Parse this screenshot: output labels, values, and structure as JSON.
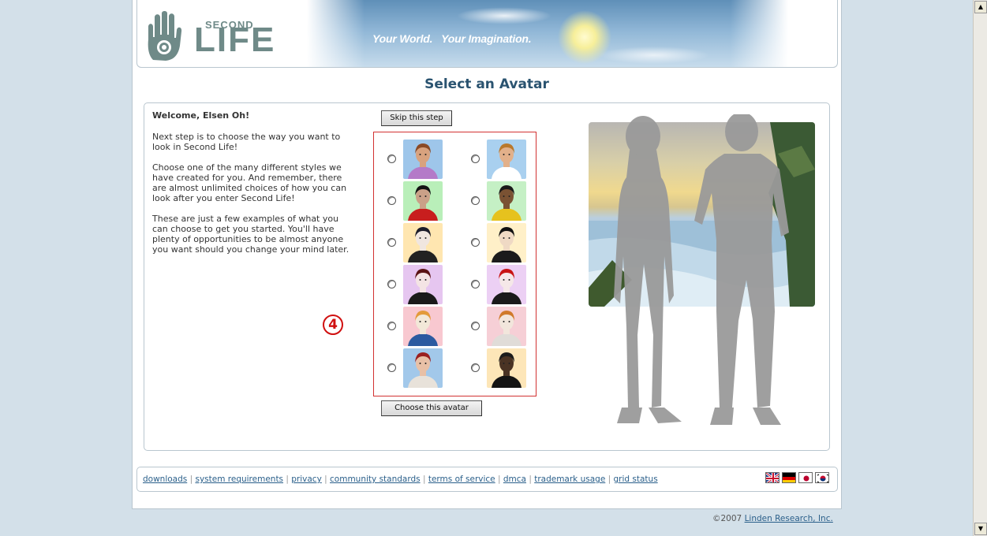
{
  "header": {
    "logo_second": "SECOND",
    "logo_life": "LIFE",
    "tagline": "Your World.   Your Imagination."
  },
  "page_title": "Select an Avatar",
  "left_panel": {
    "welcome": "Welcome, Elsen Oh!",
    "paragraphs": [
      "Next step is to choose the way you want to look in Second Life!",
      "Choose one of the many different styles we have created for you. And remember, there are almost unlimited choices of how you can look after you enter Second Life!",
      "These are just a few examples of what you can choose to get you started. You'll have plenty of opportunities to be almost anyone you want should you change your mind later."
    ]
  },
  "buttons": {
    "skip": "Skip this step",
    "choose": "Choose this avatar"
  },
  "marker": "4",
  "avatars": [
    {
      "bg": "#9ec6ea",
      "skin": "#d8a27e",
      "hair": "#8a4a26",
      "shirt": "#b47ac8"
    },
    {
      "bg": "#a9d0ef",
      "skin": "#e2b08a",
      "hair": "#b9782c",
      "shirt": "#ffffff"
    },
    {
      "bg": "#b9efb9",
      "skin": "#caa088",
      "hair": "#141414",
      "shirt": "#c81e1e"
    },
    {
      "bg": "#c5f0c5",
      "skin": "#7a5233",
      "hair": "#1a1a1a",
      "shirt": "#e6c21e"
    },
    {
      "bg": "#ffe6b0",
      "skin": "#f0e6e0",
      "hair": "#1c1c2a",
      "shirt": "#222222"
    },
    {
      "bg": "#fff0c8",
      "skin": "#efd9c4",
      "hair": "#111111",
      "shirt": "#1b1b1b"
    },
    {
      "bg": "#e6c6f0",
      "skin": "#f4e4e4",
      "hair": "#5a1414",
      "shirt": "#1a1a1a"
    },
    {
      "bg": "#ecd0f4",
      "skin": "#f5e8e8",
      "hair": "#c81414",
      "shirt": "#1a1a1a"
    },
    {
      "bg": "#f8c8d0",
      "skin": "#f2e8d8",
      "hair": "#e39a3a",
      "shirt": "#2c5aa0"
    },
    {
      "bg": "#f6cfd6",
      "skin": "#f2e6dc",
      "hair": "#d07a2a",
      "shirt": "#e0dcd8"
    },
    {
      "bg": "#a2c8ea",
      "skin": "#e8c0a6",
      "hair": "#9a2020",
      "shirt": "#e8e2da"
    },
    {
      "bg": "#fde6b8",
      "skin": "#4a3324",
      "hair": "#1c1c1c",
      "shirt": "#141414"
    }
  ],
  "footer": {
    "links": [
      "downloads",
      "system requirements",
      "privacy",
      "community standards",
      "terms of service",
      "dmca",
      "trademark usage",
      "grid status"
    ],
    "flags": [
      "uk-flag-icon",
      "germany-flag-icon",
      "japan-flag-icon",
      "korea-flag-icon"
    ]
  },
  "copyright": {
    "prefix": "©2007 ",
    "company": "Linden Research, Inc."
  }
}
